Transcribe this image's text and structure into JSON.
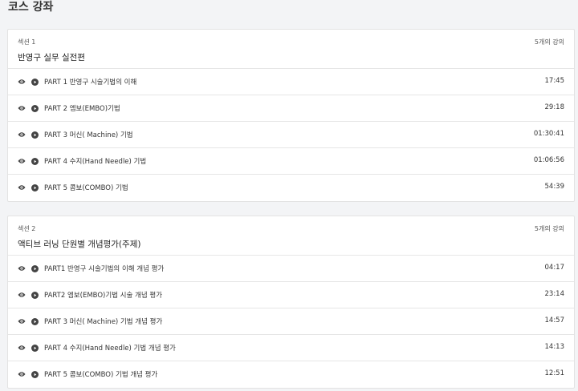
{
  "page": {
    "title": "코스 강좌"
  },
  "sections": [
    {
      "label": "섹션 1",
      "count": "5개의 강의",
      "title": "반영구 실무 실전편",
      "lectures": [
        {
          "title": "PART 1 반영구 시술기법의 이해",
          "time": "17:45"
        },
        {
          "title": "PART 2 엠보(EMBO)기법",
          "time": "29:18"
        },
        {
          "title": "PART 3 머신( Machine) 기법",
          "time": "01:30:41"
        },
        {
          "title": "PART 4 수지(Hand Needle) 기법",
          "time": "01:06:56"
        },
        {
          "title": "PART 5 콤보(COMBO) 기법",
          "time": "54:39"
        }
      ]
    },
    {
      "label": "섹션 2",
      "count": "5개의 강의",
      "title": "액티브 러닝 단원별 개념평가(주제)",
      "lectures": [
        {
          "title": "PART1 반영구 시술기법의 이해 개념 평가",
          "time": "04:17"
        },
        {
          "title": "PART2 엠보(EMBO)기법 시술 개념 평가",
          "time": "23:14"
        },
        {
          "title": "PART 3 머신( Machine) 기법 개념 평가",
          "time": "14:57"
        },
        {
          "title": "PART 4 수지(Hand Needle) 기법 개념 평가",
          "time": "14:13"
        },
        {
          "title": "PART 5 콤보(COMBO) 기법 개념 평가",
          "time": "12:51"
        }
      ]
    }
  ],
  "icons": {
    "preview": "eye-icon",
    "play": "play-circle-icon"
  },
  "colors": {
    "background": "#f3f4f6",
    "card": "#ffffff",
    "icon": "#444444"
  }
}
